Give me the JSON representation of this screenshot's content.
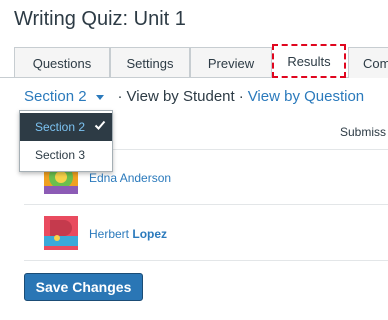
{
  "page": {
    "title": "Writing Quiz: Unit 1"
  },
  "tabs": [
    {
      "label": "Questions"
    },
    {
      "label": "Settings"
    },
    {
      "label": "Preview"
    },
    {
      "label": "Results"
    },
    {
      "label": "Com"
    }
  ],
  "view_bar": {
    "section_selected": "Section 2",
    "separator": "·",
    "view_by_student": "View by Student",
    "view_by_question": "View by Question"
  },
  "section_dropdown": {
    "options": [
      {
        "label": "Section 2",
        "selected": true
      },
      {
        "label": "Section 3",
        "selected": false
      }
    ]
  },
  "table": {
    "column_header": "Submiss"
  },
  "students": [
    {
      "first": "Edna",
      "last": "Anderson"
    },
    {
      "first": "Herbert",
      "last": "Lopez"
    }
  ],
  "actions": {
    "save_label": "Save Changes"
  },
  "colors": {
    "link": "#2b7abc",
    "text": "#2d3b45",
    "focus_outline": "#e0061f",
    "button": "#2a76b5",
    "dropdown_selected_bg": "#2d3b45",
    "dropdown_selected_text": "#7cc3f2"
  }
}
